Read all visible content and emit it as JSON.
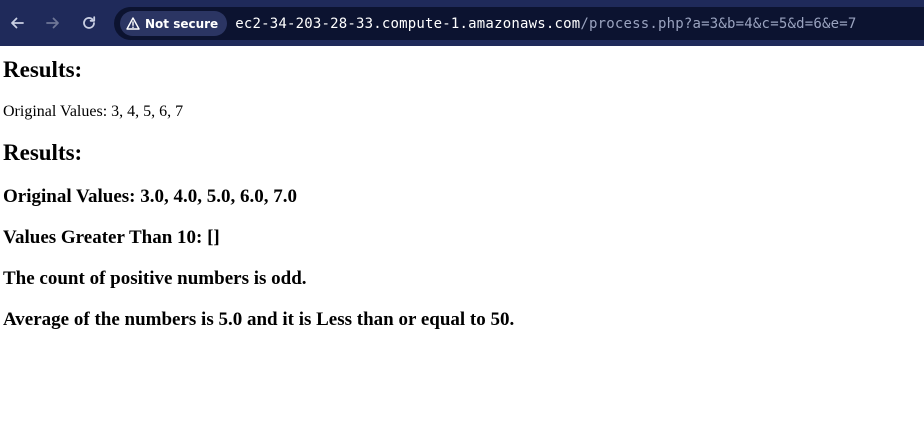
{
  "browser": {
    "security_label": "Not secure",
    "url_host": "ec2-34-203-28-33.compute-1.amazonaws.com",
    "url_path": "/process.php?a=3&b=4&c=5&d=6&e=7",
    "icons": [
      "back-arrow-icon",
      "forward-arrow-icon",
      "reload-icon",
      "warning-triangle-icon"
    ],
    "colors": {
      "toolbar": "#1f2a5a",
      "omnibox": "#0c1330",
      "chip": "#2b3563"
    }
  },
  "page": {
    "heading_1": "Results:",
    "original_values_plain": "Original Values: 3, 4, 5, 6, 7",
    "heading_2": "Results:",
    "original_values_float": "Original Values: 3.0, 4.0, 5.0, 6.0, 7.0",
    "greater_than_10": "Values Greater Than 10: []",
    "positive_count": "The count of positive numbers is odd.",
    "average": "Average of the numbers is 5.0 and it is Less than or equal to 50."
  }
}
